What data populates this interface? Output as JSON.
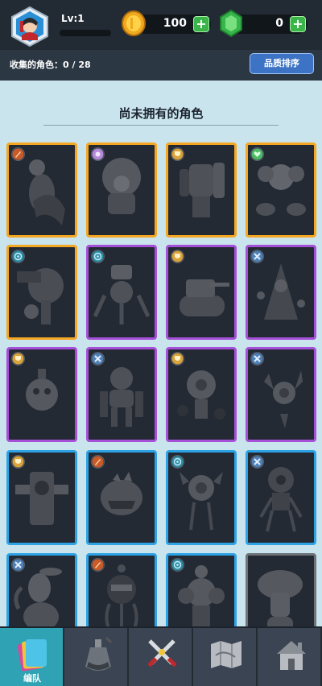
{
  "player": {
    "level_label": "Lv:1"
  },
  "currency": {
    "coins": "100",
    "gems": "0",
    "plus": "+"
  },
  "collection": {
    "label": "收集的角色：0 / 28",
    "sort_button": "品质排序"
  },
  "section": {
    "title": "尚未拥有的角色"
  },
  "cards": [
    {
      "rarity": "legend",
      "badge": "rocket"
    },
    {
      "rarity": "legend",
      "badge": "star"
    },
    {
      "rarity": "legend",
      "badge": "shield"
    },
    {
      "rarity": "legend",
      "badge": "heart"
    },
    {
      "rarity": "legend",
      "badge": "target"
    },
    {
      "rarity": "epic",
      "badge": "target"
    },
    {
      "rarity": "epic",
      "badge": "shield"
    },
    {
      "rarity": "epic",
      "badge": "cross"
    },
    {
      "rarity": "epic",
      "badge": "shield"
    },
    {
      "rarity": "epic",
      "badge": "cross"
    },
    {
      "rarity": "epic",
      "badge": "shield"
    },
    {
      "rarity": "epic",
      "badge": "cross"
    },
    {
      "rarity": "rare",
      "badge": "shield"
    },
    {
      "rarity": "rare",
      "badge": "rocket"
    },
    {
      "rarity": "rare",
      "badge": "target"
    },
    {
      "rarity": "rare",
      "badge": "cross"
    },
    {
      "rarity": "rare",
      "badge": "cross"
    },
    {
      "rarity": "rare",
      "badge": "rocket"
    },
    {
      "rarity": "rare",
      "badge": "target"
    },
    {
      "rarity": "common",
      "badge": "none"
    }
  ],
  "nav": [
    {
      "label": "编队",
      "icon": "cards-icon",
      "active": true
    },
    {
      "label": "",
      "icon": "potion-icon",
      "active": false
    },
    {
      "label": "",
      "icon": "crossed-swords-icon",
      "active": false
    },
    {
      "label": "",
      "icon": "map-icon",
      "active": false
    },
    {
      "label": "",
      "icon": "house-icon",
      "active": false
    }
  ],
  "colors": {
    "legend": "#f5a623",
    "epic": "#a64fd8",
    "rare": "#2da3e6",
    "common": "#6e7378",
    "active_tab": "#2fa3b3"
  }
}
